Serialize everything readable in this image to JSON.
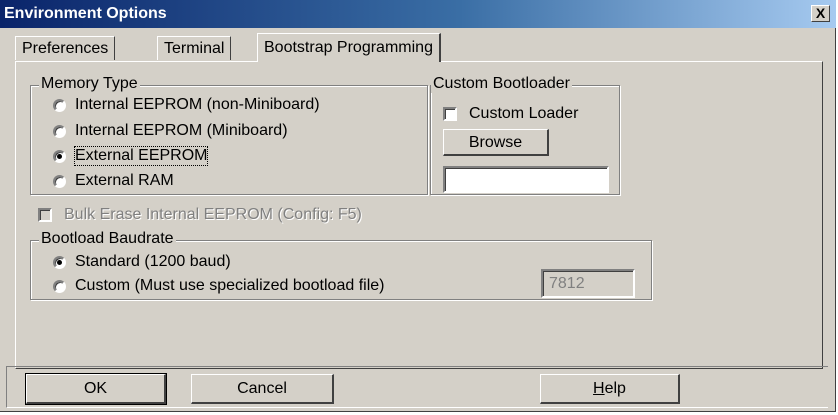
{
  "window": {
    "title": "Environment Options",
    "close_label": "X"
  },
  "tabs": [
    {
      "label": "Preferences",
      "active": false
    },
    {
      "label": "Terminal",
      "active": false
    },
    {
      "label": "Bootstrap Programming",
      "active": true
    }
  ],
  "memory_type": {
    "legend": "Memory Type",
    "options": [
      {
        "label": "Internal EEPROM (non-Miniboard)",
        "checked": false
      },
      {
        "label": "Internal EEPROM (Miniboard)",
        "checked": false
      },
      {
        "label": "External EEPROM",
        "checked": true
      },
      {
        "label": "External RAM",
        "checked": false
      }
    ]
  },
  "custom_bootloader": {
    "legend": "Custom Bootloader",
    "checkbox_label": "Custom Loader",
    "checked": false,
    "browse_label": "Browse",
    "path_value": ""
  },
  "bulk_erase": {
    "label": "Bulk Erase Internal EEPROM (Config: F5)",
    "enabled": false,
    "checked": false
  },
  "baudrate": {
    "legend": "Bootload Baudrate",
    "standard_label": "Standard (1200 baud)",
    "standard_checked": true,
    "custom_label": "Custom (Must use specialized bootload file)",
    "custom_checked": false,
    "custom_value": "7812"
  },
  "footer": {
    "ok_label": "OK",
    "cancel_label": "Cancel",
    "help_label_mnemonic": "H",
    "help_label_rest": "elp"
  }
}
